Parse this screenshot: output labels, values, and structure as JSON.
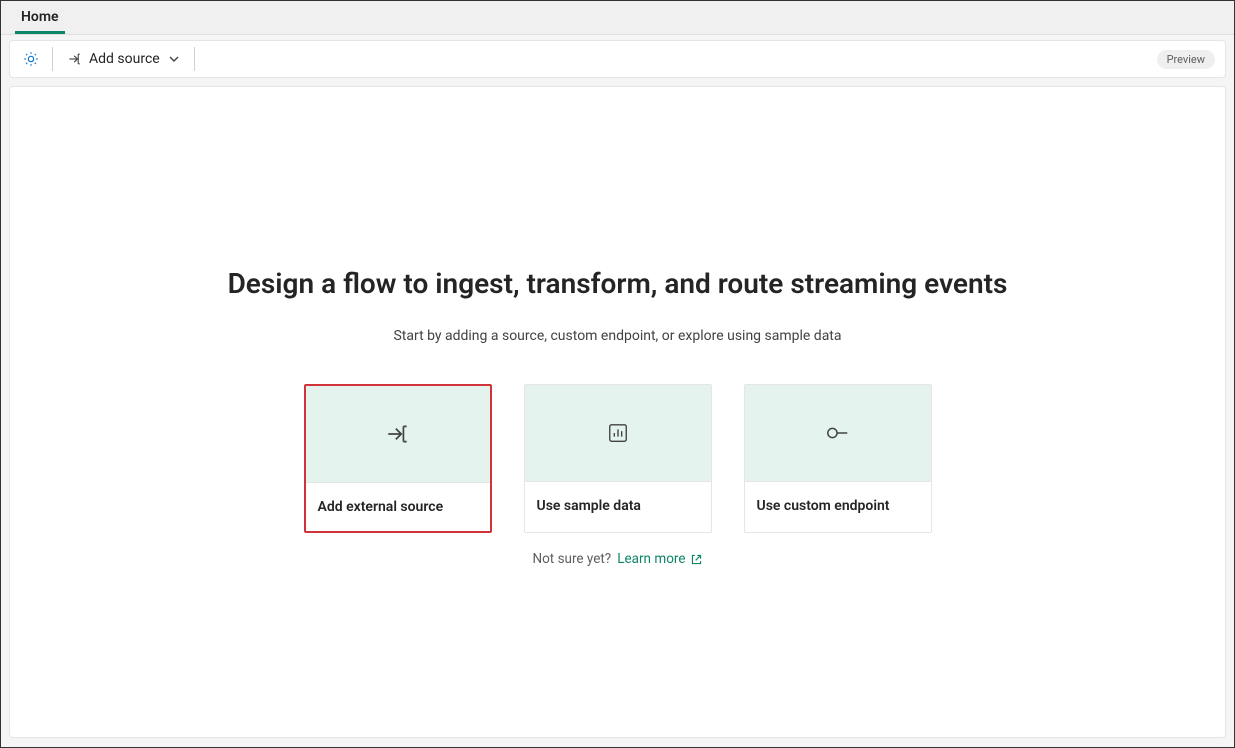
{
  "tabs": {
    "home": "Home"
  },
  "toolbar": {
    "add_source": "Add source",
    "preview_badge": "Preview"
  },
  "main": {
    "headline": "Design a flow to ingest, transform, and route streaming events",
    "subhead": "Start by adding a source, custom endpoint, or explore using sample data",
    "cards": {
      "external_source": "Add external source",
      "sample_data": "Use sample data",
      "custom_endpoint": "Use custom endpoint"
    },
    "helper": {
      "prefix": "Not sure yet?",
      "learn_more": "Learn more"
    }
  }
}
